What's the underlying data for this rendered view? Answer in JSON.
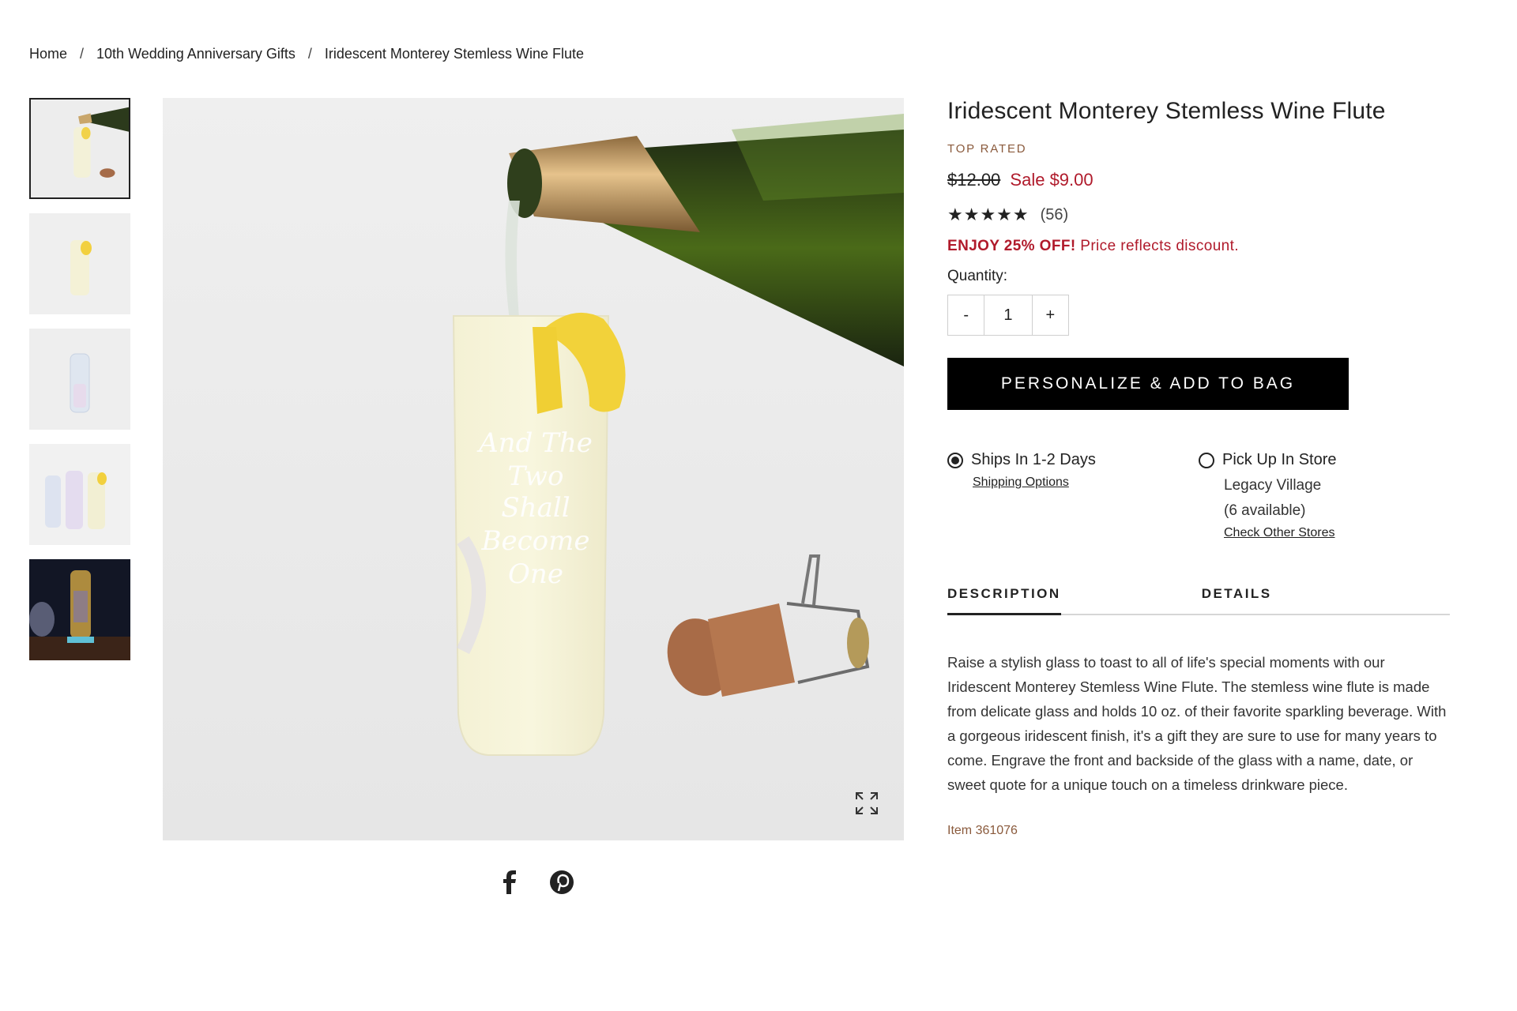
{
  "breadcrumb": {
    "home": "Home",
    "category": "10th Wedding Anniversary Gifts",
    "current": "Iridescent Monterey Stemless Wine Flute",
    "separator": "/"
  },
  "product": {
    "title": "Iridescent Monterey Stemless Wine Flute",
    "badge": "TOP RATED",
    "price_original": "$12.00",
    "price_sale": "Sale $9.00",
    "rating_value": 4.5,
    "rating_stars": "★★★★★",
    "review_count": "(56)",
    "promo_bold": "ENJOY 25% OFF!",
    "promo_text": " Price reflects discount.",
    "quantity_label": "Quantity:",
    "quantity_minus": "-",
    "quantity_value": "1",
    "quantity_plus": "+",
    "add_button": "PERSONALIZE & ADD TO BAG",
    "engraving": [
      "And The",
      "Two",
      "Shall",
      "Become",
      "One"
    ],
    "item_number": "Item 361076"
  },
  "delivery": {
    "ship": {
      "label": "Ships In 1-2 Days",
      "link": "Shipping Options",
      "selected": true
    },
    "pickup": {
      "label": "Pick Up In Store",
      "store": "Legacy Village",
      "availability": "(6 available)",
      "link": "Check Other Stores",
      "selected": false
    }
  },
  "tabs": {
    "description": "DESCRIPTION",
    "details": "DETAILS"
  },
  "description": "Raise a stylish glass to toast to all of life's special moments with our Iridescent Monterey Stemless Wine Flute. The stemless wine flute is made from delicate glass and holds 10 oz. of their favorite sparkling beverage. With a gorgeous iridescent finish, it's a gift they are sure to use for many years to come. Engrave the front and backside of the glass with a name, date, or sweet quote for a unique touch on a timeless drinkware piece.",
  "colors": {
    "sale": "#b01a2b",
    "accent_brown": "#8a5a3c",
    "button_bg": "#000000"
  },
  "icons": [
    "expand-icon",
    "facebook-icon",
    "pinterest-icon"
  ]
}
